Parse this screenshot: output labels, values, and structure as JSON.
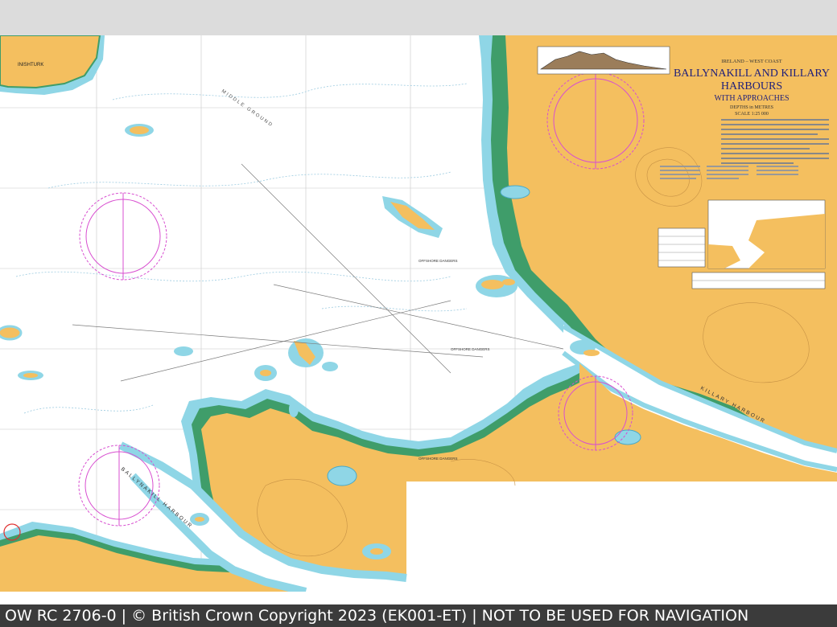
{
  "chart": {
    "region": "IRELAND – WEST COAST",
    "title_line1": "BALLYNAKILL AND KILLARY",
    "title_line2": "HARBOURS",
    "subtitle": "WITH APPROACHES",
    "depths": "DEPTHS in METRES",
    "scale": "SCALE 1:25 000"
  },
  "labels": {
    "inishturk": "INISHTURK",
    "ballynakill_harbour": "BALLYNAKILL HARBOUR",
    "killary_harbour": "KILLARY HARBOUR",
    "middle_ground": "MIDDLE GROUND",
    "offshore_dangers": "OFFSHORE DANGERS"
  },
  "colors": {
    "land": "#f4bf5f",
    "shallow": "#8fd6e6",
    "shallow_light": "#cdeef6",
    "drying": "#3f9d6a",
    "sea": "#ffffff",
    "compass": "#d84fd0"
  },
  "footer": {
    "text": "OW RC 2706-0 | © British Crown Copyright 2023 (EK001-ET) | NOT TO BE USED FOR NAVIGATION"
  }
}
